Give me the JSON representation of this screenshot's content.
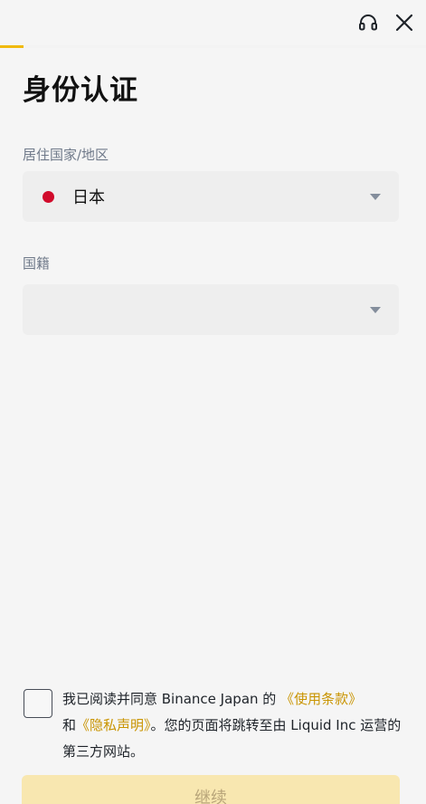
{
  "header": {
    "support_icon": "headset-icon",
    "close_icon": "close-icon",
    "progress_fraction": 0.055,
    "accent_color": "#f0b90b"
  },
  "title": "身份认证",
  "residence": {
    "label": "居住国家/地区",
    "value": "日本",
    "flag_color": "#d10b2b"
  },
  "nationality": {
    "label": "国籍",
    "value": ""
  },
  "agreement": {
    "text_before": "我已阅读并同意 Binance Japan 的",
    "terms_link": "《使用条款》",
    "and": "和",
    "privacy_link": "《隐私声明》",
    "text_after": "。您的页面将跳转至由 Liquid Inc 运营的第三方网站。",
    "checked": false
  },
  "continue_label": "继续"
}
